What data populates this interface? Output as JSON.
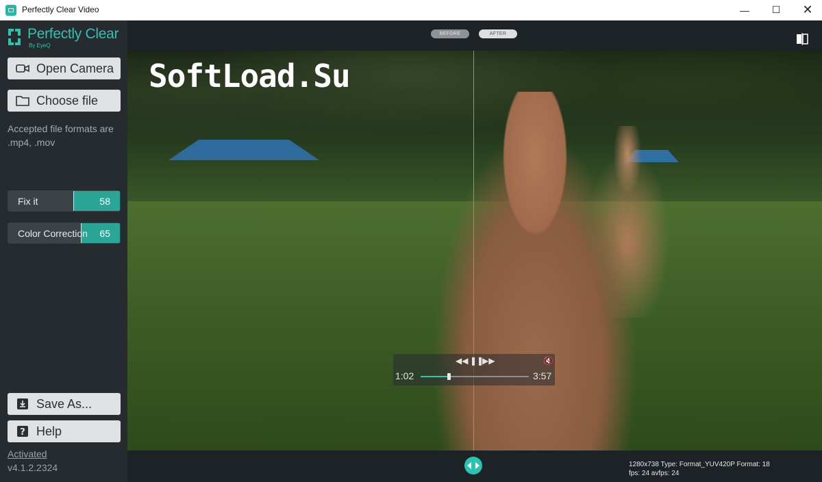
{
  "window": {
    "title": "Perfectly Clear Video",
    "minimize": "—",
    "maximize": "☐",
    "close": "✕"
  },
  "logo": {
    "title": "Perfectly Clear",
    "subtitle": "By EyeQ",
    "color": "#2fc3b0"
  },
  "sidebar": {
    "open_camera": "Open Camera",
    "choose_file": "Choose file",
    "hint": "Accepted file formats are .mp4, .mov",
    "fix_it": {
      "label": "Fix it",
      "value": "58",
      "level": 58
    },
    "color_correction": {
      "label": "Color Correction",
      "value": "65",
      "level": 65
    },
    "save_as": "Save As...",
    "help": "Help",
    "activated": "Activated",
    "version": "v4.1.2.2324"
  },
  "compare": {
    "before": "BEFORE",
    "after": "AFTER"
  },
  "viewer": {
    "watermark": "SoftLoad.Su",
    "split_position": 0.5
  },
  "player": {
    "current": "1:02",
    "total": "3:57",
    "progress": 0.26,
    "rewind": "◀◀",
    "pause": "❚❚",
    "forward": "▶▶",
    "mute": "🔇"
  },
  "status": {
    "line1": "1280x738 Type: Format_YUV420P Format: 18",
    "line2": "fps: 24 avfps: 24"
  },
  "colors": {
    "accent": "#2bb7a8",
    "sidebar": "#262b30",
    "button": "#dfe2e4"
  }
}
